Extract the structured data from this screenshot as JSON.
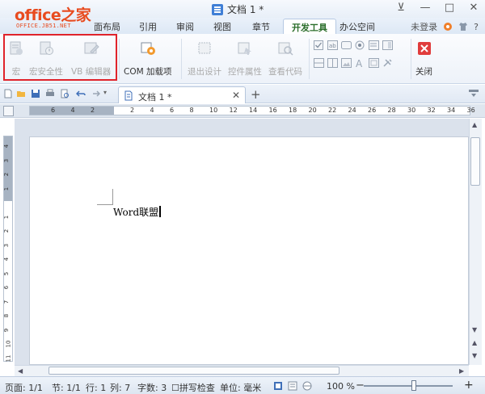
{
  "window": {
    "title": "文档 1 *",
    "logo_main": "office之家",
    "logo_sub": "OFFICE.JB51.NET"
  },
  "menu": {
    "tabs": [
      "面布局",
      "引用",
      "审阅",
      "视图",
      "章节",
      "开发工具",
      "办公空间"
    ],
    "active_tab": "开发工具",
    "login": "未登录",
    "help": "?"
  },
  "ribbon": {
    "macro": "宏",
    "macro_security": "宏安全性",
    "vb_editor": "VB 编辑器",
    "com_addins": "COM 加载项",
    "exit_design": "退出设计",
    "control_properties": "控件属性",
    "view_code": "查看代码",
    "close": "关闭"
  },
  "tabbar": {
    "doc_tab": "文档 1 *",
    "add": "+"
  },
  "ruler": {
    "ticks": [
      "6",
      "4",
      "2",
      "",
      "2",
      "4",
      "6",
      "8",
      "10",
      "12",
      "14",
      "16",
      "18",
      "20",
      "22",
      "24",
      "26",
      "28",
      "30",
      "32",
      "34",
      "36"
    ],
    "vticks": [
      "4",
      "3",
      "2",
      "1",
      "",
      "1",
      "2",
      "3",
      "4",
      "5",
      "6",
      "7",
      "8",
      "9",
      "10",
      "11"
    ]
  },
  "document": {
    "text": "Word联盟"
  },
  "status": {
    "page": "页面: 1/1",
    "section": "节: 1/1",
    "line": "行: 1",
    "column": "列: 7",
    "word_count": "字数: 3",
    "spell_check": "拼写检查",
    "unit": "单位: 毫米",
    "zoom": "100 %",
    "zoom_out": "−",
    "zoom_in": "+"
  },
  "colors": {
    "accent": "#e84b1f",
    "highlight": "#e0232b",
    "active_tab": "#2a6d2a"
  }
}
